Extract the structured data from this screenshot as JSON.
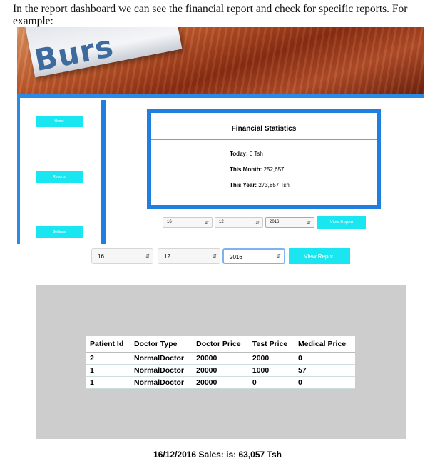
{
  "intro_text": "In the report dashboard we can see the financial report and check for specific reports. For example:",
  "banner": {
    "logo_text": "Burs"
  },
  "sidebar": {
    "items": [
      {
        "label": "Home"
      },
      {
        "label": "Reports"
      },
      {
        "label": "Settings"
      }
    ]
  },
  "stats": {
    "title": "Financial Statistics",
    "today_label": "Today:",
    "today_value": "0 Tsh",
    "month_label": "This Month:",
    "month_value": "252,657",
    "year_label": "This Year:",
    "year_value": "273,857 Tsh"
  },
  "filter_small": {
    "day": "16",
    "month": "12",
    "year": "2016",
    "button": "View Report"
  },
  "filter": {
    "day": "16",
    "month": "12",
    "year": "2016",
    "button": "View Report"
  },
  "table": {
    "columns": [
      "Patient Id",
      "Doctor Type",
      "Doctor Price",
      "Test Price",
      "Medical Price"
    ],
    "rows": [
      [
        "2",
        "NormalDoctor",
        "20000",
        "2000",
        "0"
      ],
      [
        "1",
        "NormalDoctor",
        "20000",
        "1000",
        "57"
      ],
      [
        "1",
        "NormalDoctor",
        "20000",
        "0",
        "0"
      ]
    ]
  },
  "sales_text": "16/12/2016 Sales: is: 63,057 Tsh",
  "colors": {
    "accent_blue": "#1f7fe0",
    "cyan_button": "#19e6f0",
    "panel_grey": "#cdcdcd"
  }
}
